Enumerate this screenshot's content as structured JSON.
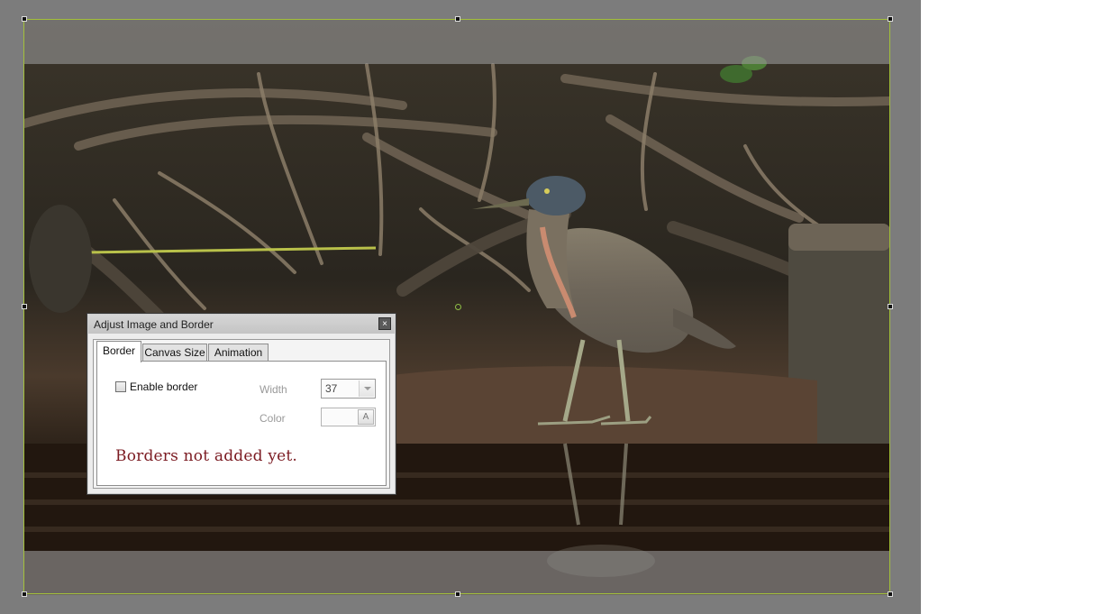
{
  "dialog": {
    "title": "Adjust Image and Border",
    "close_glyph": "×",
    "tabs": [
      {
        "label": "Border",
        "active": true
      },
      {
        "label": "Canvas Size",
        "active": false
      },
      {
        "label": "Animation",
        "active": false
      }
    ],
    "border_panel": {
      "enable_border_label": "Enable border",
      "enable_border_checked": false,
      "width_label": "Width",
      "width_value": "37",
      "color_label": "Color",
      "color_button_glyph": "A",
      "notice": "Borders not added yet."
    }
  },
  "icons": {
    "close": "close-icon",
    "dropdown": "chevron-down-icon",
    "color": "color-picker-icon"
  },
  "colors": {
    "selection_outline": "#a3c03a",
    "notice_text": "#7b1b22",
    "workspace_bg": "#7c7c7c"
  }
}
